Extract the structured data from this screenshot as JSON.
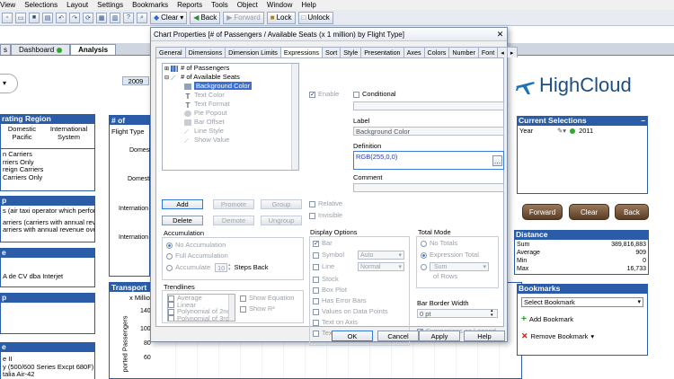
{
  "menu": [
    "View",
    "Selections",
    "Layout",
    "Settings",
    "Bookmarks",
    "Reports",
    "Tools",
    "Object",
    "Window",
    "Help"
  ],
  "toolbar": {
    "clear": "Clear",
    "back": "Back",
    "forward": "Forward",
    "lock": "Lock",
    "unlock": "Unlock"
  },
  "sheet_tabs": [
    {
      "label": "s"
    },
    {
      "label": "Dashboard"
    },
    {
      "label": "Analysis"
    }
  ],
  "year_chip": "2009",
  "left_panels": {
    "region_title": "rating Region",
    "regions": [
      "Domestic",
      "Pacific",
      "International",
      "System"
    ],
    "carriers": [
      "n Carriers",
      "rriers Only",
      "reign Carriers",
      "Carriers Only"
    ],
    "group_title": "p",
    "groups": [
      "s (air taxi operator which perfor",
      "arriers (carriers with annual reve",
      "arriers with annual revenue over"
    ],
    "p3_title": "e",
    "p3_item": "A de CV dba Interjet",
    "p4_title": "p",
    "p5_title": "e",
    "p5_items": [
      "e II",
      "y (500/600 Series Excpt 680F)",
      "talia Air-42"
    ]
  },
  "bg_chart": {
    "title": "# of Passen",
    "flight_type": "Flight Type",
    "rows": [
      "Domest",
      "Domestic",
      "Internation",
      "Internation"
    ],
    "transport_title": "Transport",
    "ylabel": "ported Passengers",
    "millions": "x Million",
    "ticks": [
      "140",
      "100",
      "80",
      "60"
    ]
  },
  "logo": "HighCloud",
  "current_selections": {
    "title": "Current Selections",
    "field": "Year",
    "value": "2011"
  },
  "nav_buttons": {
    "forward": "Forward",
    "clear": "Clear",
    "back": "Back"
  },
  "distance": {
    "title": "Distance",
    "rows": [
      {
        "label": "Sum",
        "value": "389,816,883"
      },
      {
        "label": "Average",
        "value": "909"
      },
      {
        "label": "Min",
        "value": "0"
      },
      {
        "label": "Max",
        "value": "16,733"
      }
    ]
  },
  "bookmarks": {
    "title": "Bookmarks",
    "select": "Select Bookmark",
    "add": "Add Bookmark",
    "remove": "Remove Bookmark"
  },
  "dialog": {
    "title": "Chart Properties [# of Passengers / Available Seats (x 1 million) by Flight Type]",
    "tabs": [
      "General",
      "Dimensions",
      "Dimension Limits",
      "Expressions",
      "Sort",
      "Style",
      "Presentation",
      "Axes",
      "Colors",
      "Number",
      "Font"
    ],
    "tree": [
      "# of Passengers",
      "# of Available Seats",
      "Background Color",
      "Text Color",
      "Text Format",
      "Pie Popout",
      "Bar Offset",
      "Line Style",
      "Show Value"
    ],
    "enable": "Enable",
    "conditional": "Conditional",
    "label_caption": "Label",
    "label_value": "Background Color",
    "definition_caption": "Definition",
    "definition_value": "RGB(255,0,0)",
    "comment_caption": "Comment",
    "buttons": {
      "add": "Add",
      "promote": "Promote",
      "group": "Group",
      "delete": "Delete",
      "demote": "Demote",
      "ungroup": "Ungroup"
    },
    "relative": "Relative",
    "invisible": "Invisible",
    "accumulation": {
      "caption": "Accumulation",
      "no": "No Accumulation",
      "full": "Full Accumulation",
      "acc": "Accumulate",
      "steps": "10",
      "steps_label": "Steps Back"
    },
    "trendlines": {
      "caption": "Trendlines",
      "items": [
        "Average",
        "Linear",
        "Polynomial of 2nd d",
        "Polynomial of 3rd d"
      ],
      "show_equation": "Show Equation",
      "show_r2": "Show R²"
    },
    "display_options": {
      "caption": "Display Options",
      "bar": "Bar",
      "symbol": "Symbol",
      "symbol_val": "Auto",
      "line": "Line",
      "line_val": "Normal",
      "stock": "Stock",
      "box": "Box Plot",
      "error": "Has Error Bars",
      "values": "Values on Data Points",
      "text_axis": "Text on Axis",
      "text_popup": "Text as Pop-up"
    },
    "total_mode": {
      "caption": "Total Mode",
      "no": "No Totals",
      "expr": "Expression Total",
      "sum": "Sum",
      "rows": "of Rows"
    },
    "bar_border": {
      "caption": "Bar Border Width",
      "value": "0 pt"
    },
    "expr_legend": "Expressions as Legend",
    "footer": {
      "ok": "OK",
      "cancel": "Cancel",
      "apply": "Apply",
      "help": "Help"
    }
  }
}
